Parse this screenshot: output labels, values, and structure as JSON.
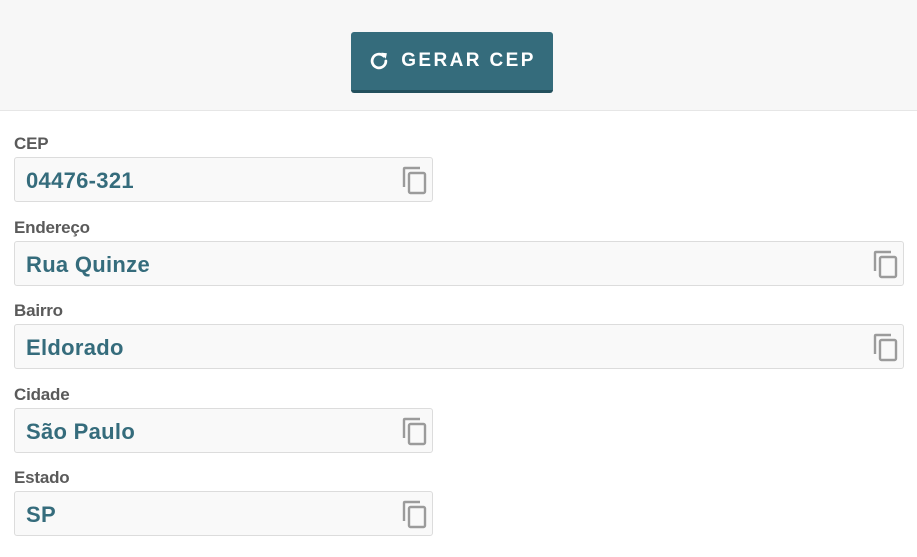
{
  "generate_button": {
    "label": "GERAR CEP",
    "icon": "refresh-icon"
  },
  "fields": {
    "cep": {
      "label": "CEP",
      "value": "04476-321",
      "copy_icon": "copy-icon"
    },
    "endereco": {
      "label": "Endereço",
      "value": "Rua Quinze",
      "copy_icon": "copy-icon"
    },
    "bairro": {
      "label": "Bairro",
      "value": "Eldorado",
      "copy_icon": "copy-icon"
    },
    "cidade": {
      "label": "Cidade",
      "value": "São Paulo",
      "copy_icon": "copy-icon"
    },
    "estado": {
      "label": "Estado",
      "value": "SP",
      "copy_icon": "copy-icon"
    }
  },
  "colors": {
    "accent": "#356c7c",
    "label_text": "#5a5a5a",
    "field_background": "#f9f9f9",
    "header_background": "#f7f7f7"
  }
}
